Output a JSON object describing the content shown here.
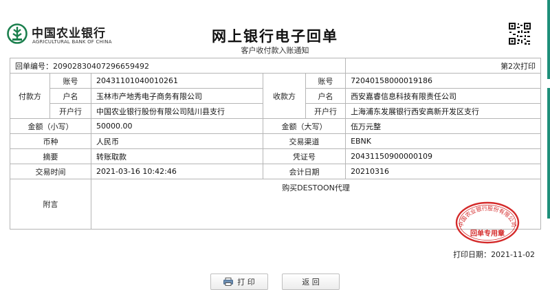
{
  "header": {
    "bank_name_cn": "中国农业银行",
    "bank_name_en": "AGRICULTURAL BANK OF CHINA",
    "title": "网上银行电子回单",
    "subtitle": "客户收付款入账通知"
  },
  "receipt": {
    "number_label": "回单编号：",
    "number": "20902830407296659492",
    "print_count": "第2次打印",
    "payer": {
      "section_label": "付款方",
      "account_label": "账号",
      "account": "20431101040010261",
      "name_label": "户名",
      "name": "玉林市产地秀电子商务有限公司",
      "bank_label": "开户行",
      "bank": "中国农业银行股份有限公司陆川县支行"
    },
    "payee": {
      "section_label": "收款方",
      "account_label": "账号",
      "account": "72040158000019186",
      "name_label": "户名",
      "name": "西安嘉睿信息科技有限责任公司",
      "bank_label": "开户行",
      "bank": "上海浦东发展银行西安高新开发区支行"
    },
    "amount_small_label": "金额（小写）",
    "amount_small": "50000.00",
    "amount_big_label": "金额（大写）",
    "amount_big": "伍万元整",
    "currency_label": "币种",
    "currency": "人民币",
    "channel_label": "交易渠道",
    "channel": "EBNK",
    "summary_label": "摘要",
    "summary": "转账取款",
    "voucher_label": "凭证号",
    "voucher": "20431150900000109",
    "time_label": "交易时间",
    "time": "2021-03-16 10:42:46",
    "accounting_date_label": "会计日期",
    "accounting_date": "20210316",
    "remark_label": "附言",
    "remark": "购买DESTOON代理",
    "seal_text": "中国农业银行股份有限公司",
    "seal_label": "回单专用章"
  },
  "footer": {
    "print_date_label": "打印日期：",
    "print_date": "2021-11-02"
  },
  "buttons": {
    "print": "打 印",
    "back": "返 回"
  },
  "colors": {
    "bank_green": "#1b7f4d",
    "seal_red": "#d42a2a",
    "edge_green": "#1f8f7a"
  }
}
